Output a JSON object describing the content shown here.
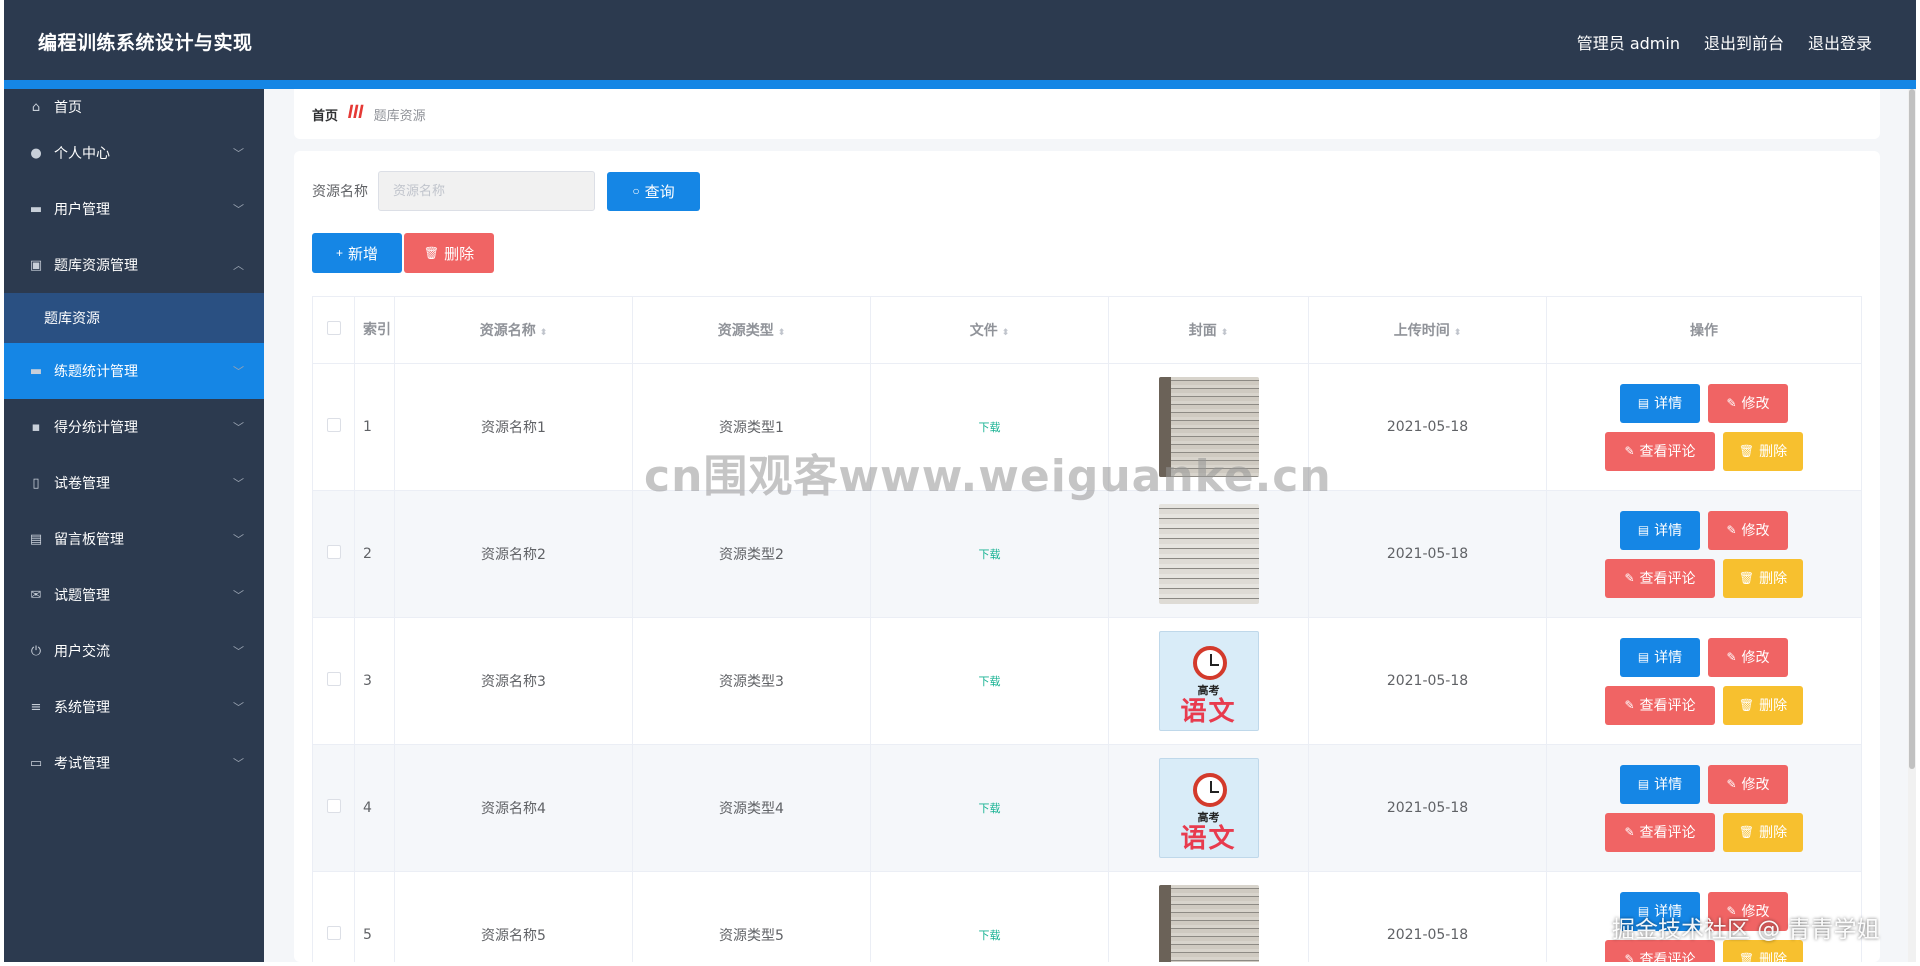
{
  "header": {
    "title": "编程训练系统设计与实现",
    "admin": "管理员 admin",
    "to_front": "退出到前台",
    "logout": "退出登录"
  },
  "sidebar": {
    "items": [
      {
        "label": "首页",
        "icon": "home-icon"
      },
      {
        "label": "个人中心",
        "icon": "user-icon"
      },
      {
        "label": "用户管理",
        "icon": "monitor-icon"
      },
      {
        "label": "题库资源管理",
        "icon": "clipboard-icon"
      },
      {
        "label": "题库资源",
        "icon": ""
      },
      {
        "label": "练题统计管理",
        "icon": "monitor-icon"
      },
      {
        "label": "得分统计管理",
        "icon": "chat-icon"
      },
      {
        "label": "试卷管理",
        "icon": "phone-icon"
      },
      {
        "label": "留言板管理",
        "icon": "document-icon"
      },
      {
        "label": "试题管理",
        "icon": "mail-icon"
      },
      {
        "label": "用户交流",
        "icon": "power-icon"
      },
      {
        "label": "系统管理",
        "icon": "sliders-icon"
      },
      {
        "label": "考试管理",
        "icon": "message-icon"
      }
    ]
  },
  "breadcrumb": {
    "home": "首页",
    "current": "题库资源"
  },
  "search": {
    "label": "资源名称",
    "placeholder": "资源名称",
    "query_button": "查询"
  },
  "actions": {
    "add": "新增",
    "delete": "删除"
  },
  "table": {
    "columns": [
      "索引",
      "资源名称",
      "资源类型",
      "文件",
      "封面",
      "上传时间",
      "操作"
    ],
    "rows": [
      {
        "index": "1",
        "name": "资源名称1",
        "type": "资源类型1",
        "file": "下载",
        "cover": "paper-photo",
        "date": "2021-05-18"
      },
      {
        "index": "2",
        "name": "资源名称2",
        "type": "资源类型2",
        "file": "下载",
        "cover": "paper-photo",
        "date": "2021-05-18"
      },
      {
        "index": "3",
        "name": "资源名称3",
        "type": "资源类型3",
        "file": "下载",
        "cover": "chinese-exam",
        "date": "2021-05-18"
      },
      {
        "index": "4",
        "name": "资源名称4",
        "type": "资源类型4",
        "file": "下载",
        "cover": "chinese-exam",
        "date": "2021-05-18"
      },
      {
        "index": "5",
        "name": "资源名称5",
        "type": "资源类型5",
        "file": "下载",
        "cover": "paper-photo",
        "date": "2021-05-18"
      }
    ],
    "ops": {
      "detail": "详情",
      "edit": "修改",
      "comment": "查看评论",
      "delete": "删除"
    }
  },
  "cover_text": {
    "sub": "高考",
    "main": "语文"
  },
  "watermarks": {
    "center": "cn围观客www.weiguanke.cn",
    "bottom": "掘金技术社区 @ 青青学姐"
  },
  "colors": {
    "header_bg": "#2c3a4f",
    "primary": "#1586e5",
    "danger": "#f06464",
    "warning": "#f7c02f",
    "download": "#1ab394",
    "submenu_bg": "#2a5082"
  }
}
